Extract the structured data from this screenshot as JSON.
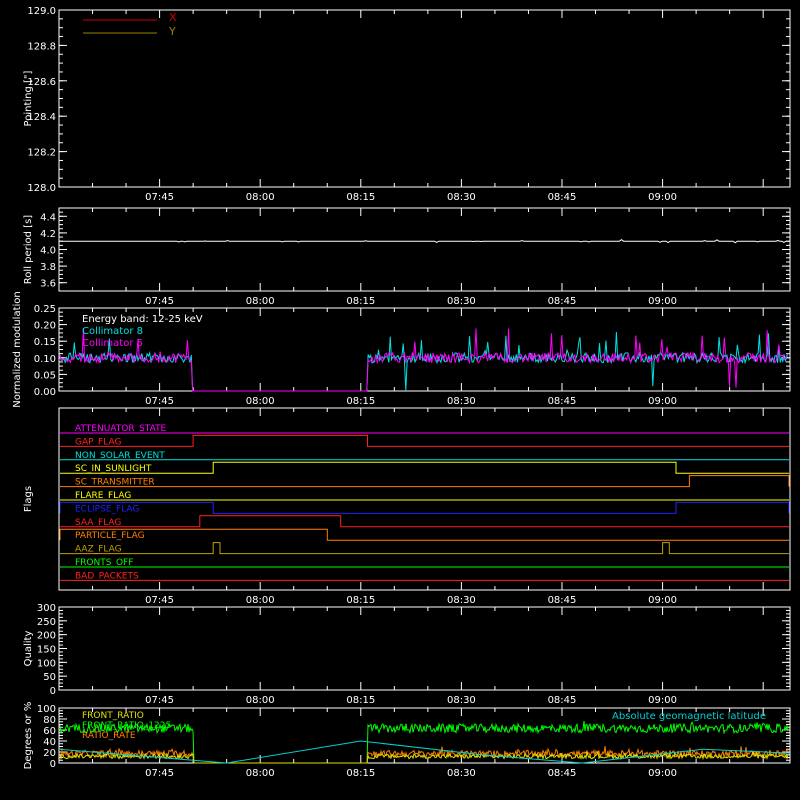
{
  "colors": {
    "background": "#000000",
    "axes": "#ffffff",
    "x_trace": "#d00000",
    "y_trace": "#a08000",
    "roll": "#ffffff",
    "collimator8": "#00e0e0",
    "collimator5": "#ff00ff",
    "front_ratio": "#e0e000",
    "front_ratio_1225": "#00ff00",
    "rate": "#ff8000",
    "geomag": "#00d0d0"
  },
  "time_ticks": [
    "07:45",
    "08:00",
    "08:15",
    "08:30",
    "08:45",
    "09:00"
  ],
  "chart_data": [
    {
      "type": "line",
      "ylabel": "Pointing [\"]",
      "ylim": [
        128.0,
        129.0
      ],
      "yticks": [
        "128.0",
        "128.2",
        "128.4",
        "128.6",
        "128.8",
        "129.0"
      ],
      "legend_placement": "top-left",
      "series": [
        {
          "name": "X",
          "values": [],
          "color": "#d00000"
        },
        {
          "name": "Y",
          "values": [],
          "color": "#a08000"
        }
      ]
    },
    {
      "type": "line",
      "ylabel": "Roll period [s]",
      "ylim": [
        3.5,
        4.5
      ],
      "yticks": [
        "3.6",
        "3.8",
        "4.0",
        "4.2",
        "4.4"
      ],
      "series": [
        {
          "values": [
            4.1,
            4.1,
            4.1,
            4.1,
            4.1,
            4.1,
            4.1,
            4.1,
            4.1,
            4.1,
            4.1,
            4.1,
            4.1,
            4.1
          ]
        }
      ]
    },
    {
      "type": "line",
      "ylabel": "Normalized modulation",
      "ylim": [
        0.0,
        0.25
      ],
      "yticks": [
        "0.00",
        "0.05",
        "0.10",
        "0.15",
        "0.20",
        "0.25"
      ],
      "annotation": "Energy band: 12-25 keV",
      "legend_placement": "top-left",
      "series": [
        {
          "name": "Collimator 8",
          "color": "#00e0e0"
        },
        {
          "name": "Collimator 5",
          "color": "#ff00ff"
        }
      ],
      "data_gap": [
        "07:50",
        "08:16"
      ],
      "typical_level": 0.1
    },
    {
      "type": "line",
      "ylabel": "Flags",
      "flags": [
        {
          "name": "ATTENUATOR_STATE",
          "color": "#ff00ff",
          "high": []
        },
        {
          "name": "GAP_FLAG",
          "color": "#ff2020",
          "high": [
            [
              "07:50",
              "08:16"
            ]
          ]
        },
        {
          "name": "NON_SOLAR_EVENT",
          "color": "#00e0e0",
          "high": []
        },
        {
          "name": "SC_IN_SUNLIGHT",
          "color": "#ffff00",
          "high": [
            [
              "07:53",
              "09:02"
            ]
          ]
        },
        {
          "name": "SC_TRANSMITTER",
          "color": "#ff8000",
          "high": [
            [
              "09:04",
              "09:19"
            ]
          ]
        },
        {
          "name": "FLARE_FLAG",
          "color": "#ffff00",
          "high": []
        },
        {
          "name": "ECLIPSE_FLAG",
          "color": "#2020ff",
          "high": [
            [
              "07:30",
              "07:53"
            ],
            [
              "09:02",
              "09:19"
            ]
          ]
        },
        {
          "name": "SAA_FLAG",
          "color": "#ff2020",
          "high": [
            [
              "07:51",
              "08:12"
            ]
          ]
        },
        {
          "name": "PARTICLE_FLAG",
          "color": "#ff8000",
          "high": [
            [
              "07:30",
              "08:10"
            ]
          ]
        },
        {
          "name": "AAZ_FLAG",
          "color": "#c0a000",
          "high": [
            [
              "07:53",
              "07:54"
            ],
            [
              "09:00",
              "09:01"
            ]
          ]
        },
        {
          "name": "FRONTS_OFF",
          "color": "#00ff00",
          "high": []
        },
        {
          "name": "BAD_PACKETS",
          "color": "#ff2020",
          "high": []
        }
      ]
    },
    {
      "type": "line",
      "ylabel": "Quality",
      "ylim": [
        0,
        300
      ],
      "yticks": [
        "0",
        "50",
        "100",
        "150",
        "200",
        "250",
        "300"
      ],
      "series": []
    },
    {
      "type": "line",
      "ylabel": "Degrees or %",
      "ylim": [
        0,
        100
      ],
      "yticks": [
        "0",
        "20",
        "40",
        "60",
        "80",
        "100"
      ],
      "series": [
        {
          "name": "FRONT_RATIO",
          "color": "#e0e000"
        },
        {
          "name": "FRONT_RATIO_1225",
          "color": "#00ff00",
          "typical_level": 63
        },
        {
          "name": "RATIO_RATE",
          "color": "#ff8000",
          "typical_level": 17
        },
        {
          "name": "Absolute geomagnetic latitude",
          "color": "#00d0d0",
          "x": [
            "07:30",
            "07:55",
            "08:15",
            "08:33",
            "08:48",
            "09:06",
            "09:19"
          ],
          "values": [
            25,
            0,
            40,
            15,
            0,
            25,
            18
          ]
        }
      ]
    }
  ]
}
